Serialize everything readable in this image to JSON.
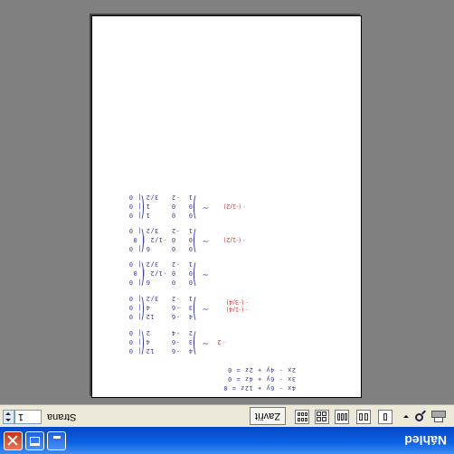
{
  "window": {
    "title": "Náhled"
  },
  "toolbar": {
    "close_label": "Zavřít",
    "page_label": "Strana",
    "page_value": "1",
    "icons": [
      "print-icon",
      "zoom-icon",
      "one-page-icon",
      "two-pages-icon",
      "three-pages-icon",
      "four-pages-icon",
      "six-pages-icon"
    ]
  },
  "page": {
    "blocks": [
      {
        "rows": [
          "4  -6    12 | 0",
          "3  -6     4 | 0",
          "2  -4     2 | 0"
        ],
        "note": "· 2"
      },
      {
        "rows": [
          "4  -6    12 | 0",
          "3  -6     4 | 0",
          "1  -2   3/2 | 0"
        ],
        "note": "· (-1/4)\n· (-3/4)"
      },
      {
        "rows": [
          "0   0     6 | 0",
          "0   0 -1/2 | 0",
          "1  -2   3/2 | 0"
        ],
        "note": ""
      },
      {
        "rows": [
          "0   0     6 | 0",
          "0   0 -1/2 | 0",
          "1  -2   3/2 | 0"
        ],
        "note": "· (-1/2)"
      },
      {
        "rows": [
          "0   0     1 | 0",
          "0   0     1 | 0",
          "1  -2   3/2 | 0"
        ],
        "note": "· (-1/2)"
      }
    ],
    "equations": [
      "4x - 6y + 12z = 0",
      "3x - 6y + 4z = 0",
      "2x - 4y + 2z = 0"
    ]
  }
}
